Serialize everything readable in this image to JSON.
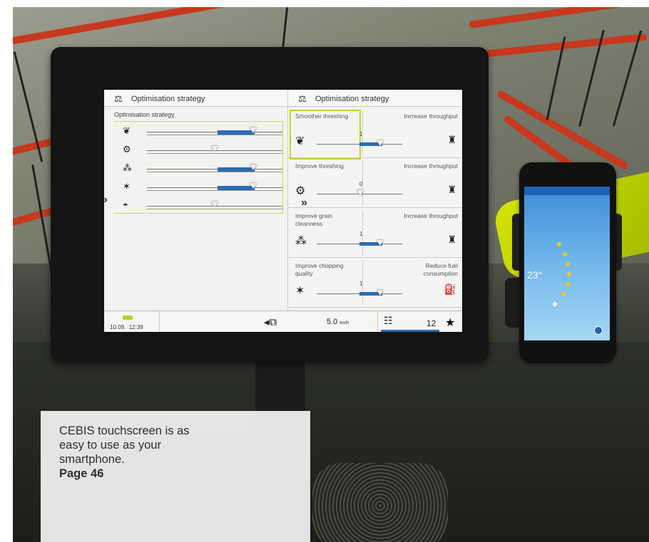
{
  "screen": {
    "left_pane": {
      "title": "Optimisation strategy",
      "subtitle": "Optimisation strategy",
      "expand_icon": "double-chevron-right-icon",
      "sliders": [
        {
          "icon": "threshing-icon",
          "fill_from": 0.52,
          "fill_to": 0.78,
          "knob": 0.76
        },
        {
          "icon": "separation-icon",
          "fill_from": 0.5,
          "fill_to": 0.5,
          "knob": 0.5
        },
        {
          "icon": "cleaning-icon",
          "fill_from": 0.5,
          "fill_to": 0.78,
          "knob": 0.76
        },
        {
          "icon": "chopping-icon",
          "fill_from": 0.5,
          "fill_to": 0.78,
          "knob": 0.76
        },
        {
          "icon": "fuel-icon",
          "fill_from": 0.5,
          "fill_to": 0.5,
          "knob": 0.5
        }
      ]
    },
    "right_pane": {
      "title": "Optimisation strategy",
      "options": [
        {
          "left": "Smoother threshing",
          "right": "Increase throughput",
          "value": "1",
          "level": 0.7,
          "selected": true
        },
        {
          "left": "Improve threshing",
          "right": "Increase throughput",
          "value": "0",
          "level": 0.5,
          "selected": false
        },
        {
          "left": "Improve grain cleanness",
          "right": "Increase throughput",
          "value": "1",
          "level": 0.7,
          "selected": false
        },
        {
          "left": "Improve chopping quality",
          "right": "Reduce fuel consumption",
          "value": "1",
          "level": 0.7,
          "selected": false
        }
      ]
    },
    "footer": {
      "date": "10.09.",
      "time": "12:39",
      "speed": "5.0",
      "speed_unit": "km/h",
      "count": "12"
    }
  },
  "phone": {
    "temperature": "23°"
  },
  "caption": {
    "text": "CEBIS touchscreen is as easy to use as your smartphone.",
    "page_ref": "Page 46"
  },
  "colors": {
    "accent_green": "#c5d42c",
    "slider_blue": "#2a6db0",
    "reel_red": "#c7381e"
  }
}
